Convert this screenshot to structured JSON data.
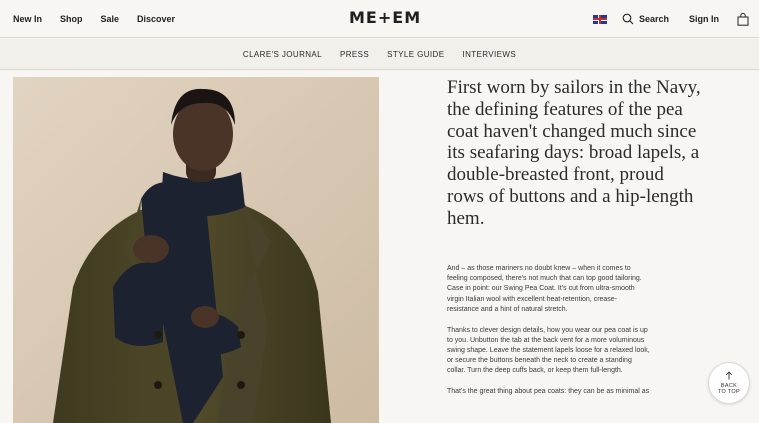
{
  "header": {
    "nav_left": [
      "New In",
      "Shop",
      "Sale",
      "Discover"
    ],
    "logo": "ME+EM",
    "search_label": "Search",
    "signin_label": "Sign In"
  },
  "subnav": [
    "CLARE'S JOURNAL",
    "PRESS",
    "STYLE GUIDE",
    "INTERVIEWS"
  ],
  "article": {
    "headline_lines": [
      "First worn by sailors in the Navy,",
      "the defining features of the pea",
      "coat haven't changed much since",
      "its seafaring days: broad lapels, a",
      "double-breasted front, proud",
      "rows of buttons and a hip-length",
      "hem."
    ],
    "paragraphs": [
      [
        "And – as those mariners no doubt knew – when it comes to",
        "feeling composed, there's not much that can top good tailoring.",
        "Case in point: our Swing Pea Coat. It's cut from ultra-smooth",
        "virgin Italian wool with excellent heat-retention, crease-",
        "resistance and a hint of natural stretch."
      ],
      [
        "Thanks to clever design details, how you wear our pea coat is up",
        "to you. Unbutton the tab at the back vent for a more voluminous",
        "swing shape. Leave the statement lapels loose for a relaxed look,",
        "or secure the buttons beneath the neck to create a standing",
        "collar. Turn the deep cuffs back, or keep them full-length."
      ],
      [
        "That's the great thing about pea coats: they can be as minimal as"
      ]
    ]
  },
  "back_to_top": [
    "BACK",
    "TO TOP"
  ],
  "colors": {
    "background": "#f7f6f2",
    "coat": "#4a4526",
    "sweater": "#1c2230"
  },
  "icons": [
    "uk-flag-icon",
    "search-icon",
    "bag-icon",
    "arrow-up-icon"
  ]
}
